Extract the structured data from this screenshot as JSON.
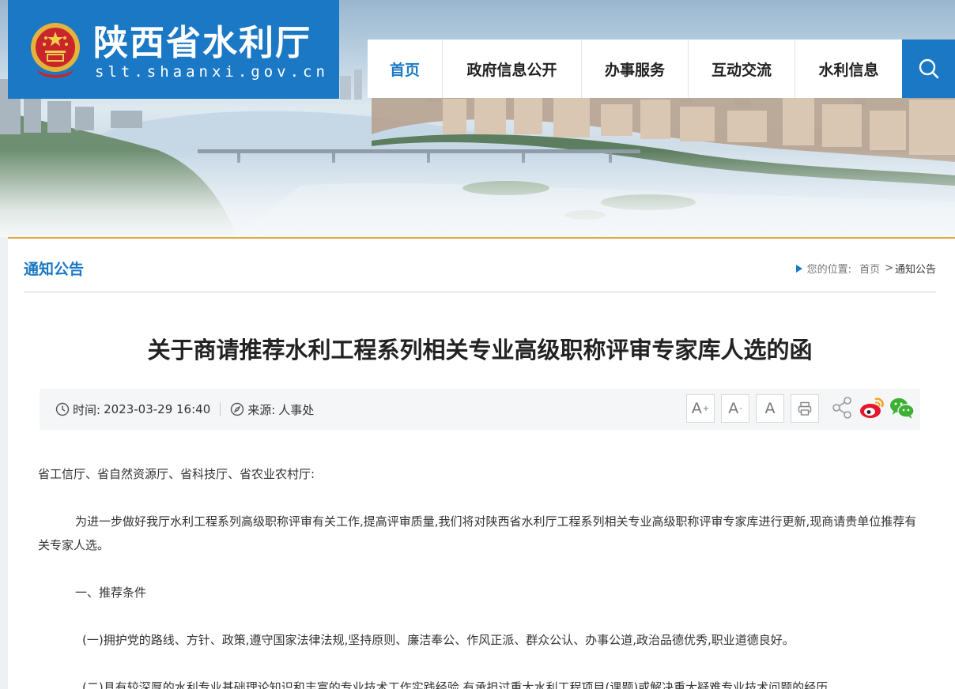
{
  "header": {
    "site_title": "陕西省水利厅",
    "site_domain": "slt.shaanxi.gov.cn",
    "emblem_icon": "national-emblem-icon",
    "brand_color": "#1b78c4",
    "accent_color": "#e3a53a"
  },
  "nav": {
    "items": [
      {
        "label": "首页",
        "active": true
      },
      {
        "label": "政府信息公开",
        "active": false
      },
      {
        "label": "办事服务",
        "active": false
      },
      {
        "label": "互动交流",
        "active": false
      },
      {
        "label": "水利信息",
        "active": false
      }
    ],
    "search_icon": "search-icon"
  },
  "page": {
    "section_title": "通知公告",
    "breadcrumb": {
      "prefix": "您的位置:",
      "home": "首页",
      "separator": ">",
      "current": "通知公告"
    }
  },
  "article": {
    "title": "关于商请推荐水利工程系列相关专业高级职称评审专家库人选的函",
    "time_label": "时间:",
    "time_value": "2023-03-29 16:40",
    "source_label": "来源:",
    "source_value": "人事处",
    "font_buttons": [
      "A",
      "A",
      "A"
    ],
    "font_button_marks": [
      "+",
      "-",
      ""
    ],
    "share_icons": [
      "share-icon",
      "weibo-icon",
      "wechat-icon"
    ],
    "paragraphs": [
      "省工信厅、省自然资源厅、省科技厅、省农业农村厅:",
      "为进一步做好我厅水利工程系列高级职称评审有关工作,提高评审质量,我们将对陕西省水利厅工程系列相关专业高级职称评审专家库进行更新,现商请贵单位推荐有关专家人选。",
      "一、推荐条件",
      "(一)拥护党的路线、方针、政策,遵守国家法律法规,坚持原则、廉洁奉公、作风正派、群众公认、办事公道,政治品德优秀,职业道德良好。",
      "(二)具有较深厚的水利专业基础理论知识和丰富的专业技术工作实践经验,有承担过重大水利工程项目(课题)或解决重大疑难专业技术问题的经历,"
    ]
  }
}
